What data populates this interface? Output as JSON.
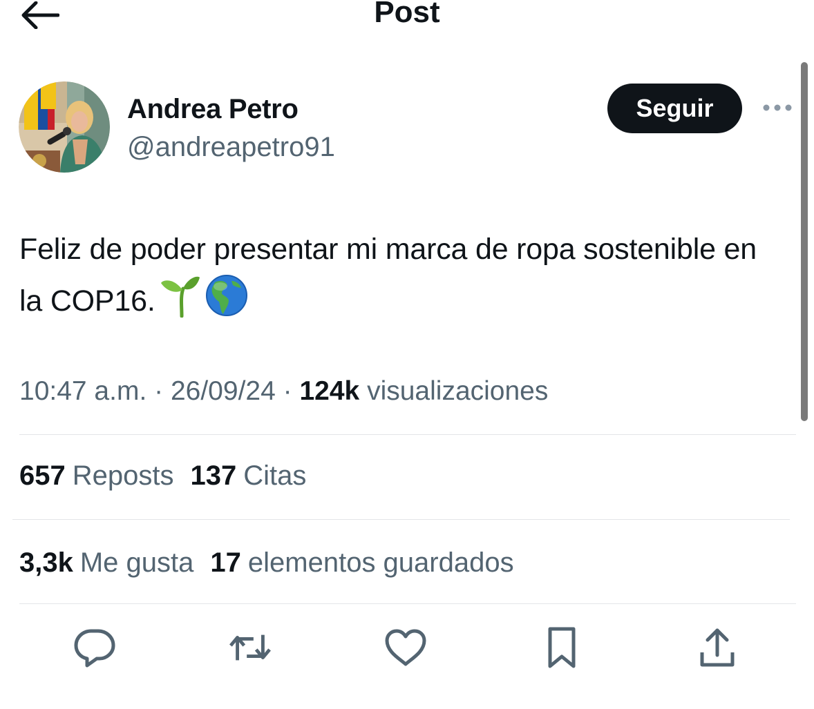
{
  "header": {
    "title": "Post",
    "back_icon": "arrow-left-icon"
  },
  "author": {
    "name": "Andrea Petro",
    "handle": "@andreapetro91",
    "follow_label": "Seguir",
    "more_icon": "more-dots-icon"
  },
  "tweet": {
    "text": "Feliz de poder presentar mi marca de ropa sostenible en la COP16.",
    "emojis": [
      "seedling-icon",
      "globe-americas-icon"
    ]
  },
  "meta": {
    "time": "10:47 a.m.",
    "separator": "·",
    "date": "26/09/24",
    "views_count": "124k",
    "views_label": "visualizaciones"
  },
  "stats": {
    "reposts_count": "657",
    "reposts_label": "Reposts",
    "quotes_count": "137",
    "quotes_label": "Citas",
    "likes_count": "3,3k",
    "likes_label": "Me gusta",
    "bookmarks_count": "17",
    "bookmarks_label": "elementos guardados"
  },
  "actions": [
    "reply-icon",
    "repost-icon",
    "like-icon",
    "bookmark-icon",
    "share-icon"
  ],
  "colors": {
    "text_primary": "#0f1419",
    "text_secondary": "#536471",
    "button_bg": "#0f1419",
    "divider": "#e3e5e8",
    "icon": "#536471"
  }
}
